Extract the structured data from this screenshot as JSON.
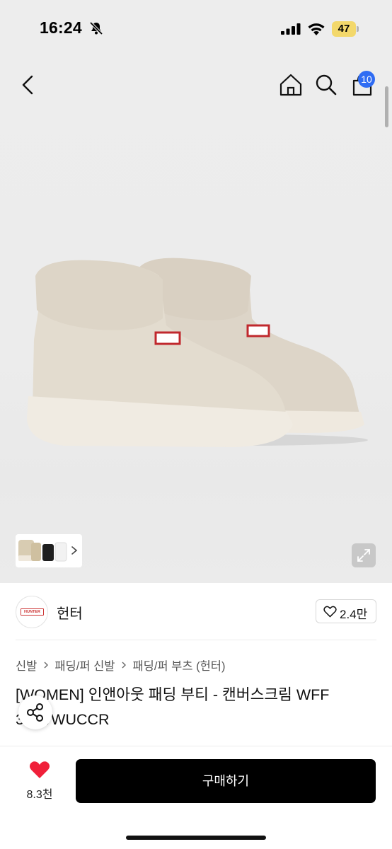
{
  "status_bar": {
    "time": "16:24",
    "battery_level": "47",
    "icons": [
      "bell-slash-icon",
      "cellular-signal-icon",
      "wifi-icon",
      "battery-icon"
    ]
  },
  "nav": {
    "icons": [
      "chevron-left-icon",
      "home-icon",
      "search-icon",
      "shopping-bag-icon"
    ],
    "cart_count": "10"
  },
  "gallery": {
    "thumbnail_icons": [
      "boot-thumbnail",
      "chevron-right-icon"
    ],
    "expand_icon": "expand-icon"
  },
  "brand": {
    "logo_text": "HUNTER",
    "name": "헌터",
    "likes": "2.4만"
  },
  "breadcrumb": [
    "신발",
    "패딩/퍼 신발",
    "패딩/퍼 부츠 (헌터)"
  ],
  "product": {
    "title_line1": "[WOMEN] 인앤아웃 패딩 부티 - 캔버스크림 WFF",
    "title_line2": "3...WWUCCR"
  },
  "bottom_bar": {
    "wish_count": "8.3천",
    "buy_label": "구매하기"
  },
  "colors": {
    "accent_blue": "#2f6cf3",
    "heart_red": "#f0203a",
    "buy_button": "#000000",
    "battery_yellow": "#f3d86b"
  }
}
